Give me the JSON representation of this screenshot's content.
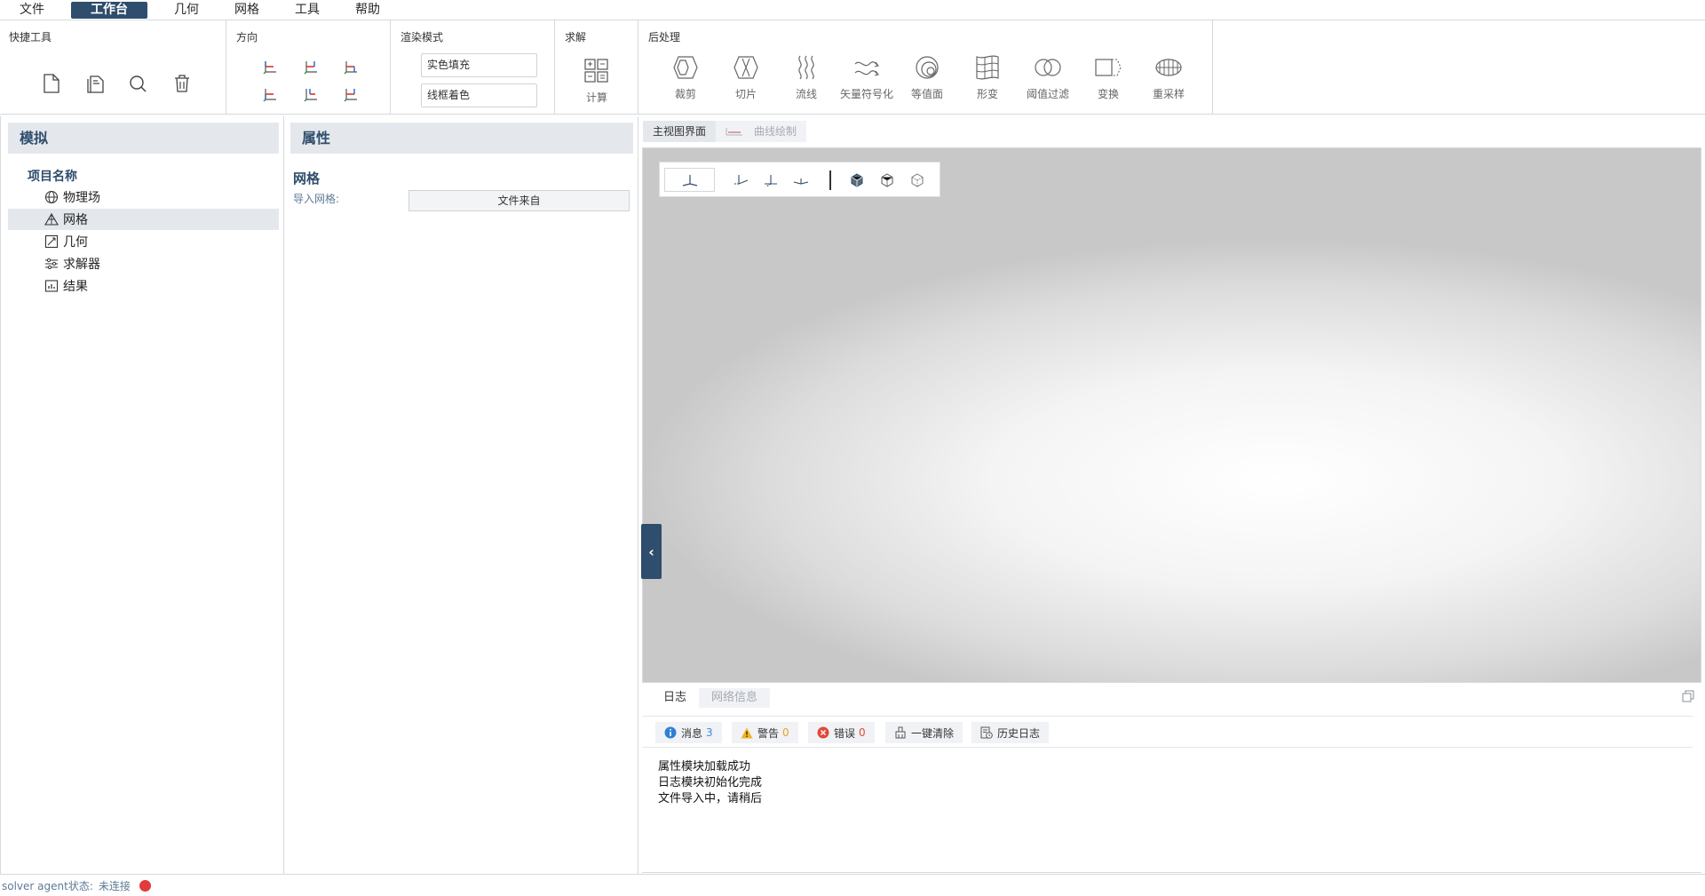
{
  "menu": {
    "items": [
      "文件",
      "工作台",
      "几何",
      "网格",
      "工具",
      "帮助"
    ],
    "active_index": 1
  },
  "ribbon": {
    "quick_tools": {
      "title": "快捷工具",
      "buttons": [
        "new-file-icon",
        "copy-file-icon",
        "search-icon",
        "trash-icon"
      ]
    },
    "direction": {
      "title": "方向",
      "buttons": [
        "view-x-pos-icon",
        "view-y-pos-icon",
        "view-z-pos-icon",
        "view-x-neg-icon",
        "view-y-neg-icon",
        "view-z-neg-icon"
      ]
    },
    "render_mode": {
      "title": "渲染模式",
      "options": [
        "实色填充",
        "线框着色"
      ]
    },
    "solve": {
      "title": "求解",
      "compute_label": "计算"
    },
    "postprocess": {
      "title": "后处理",
      "tools": [
        "裁剪",
        "切片",
        "流线",
        "矢量符号化",
        "等值面",
        "形变",
        "阈值过滤",
        "变换",
        "重采样"
      ]
    }
  },
  "left_panel": {
    "header": "模拟",
    "root": "项目名称",
    "items": [
      "物理场",
      "网格",
      "几何",
      "求解器",
      "结果"
    ],
    "selected_index": 1
  },
  "property_panel": {
    "header": "属性",
    "section_title": "网格",
    "import_label": "导入网格:",
    "import_button": "文件来自"
  },
  "view": {
    "tabs": [
      "主视图界面",
      "曲线绘制"
    ],
    "active_tab": 0
  },
  "log": {
    "tabs": [
      "日志",
      "网络信息"
    ],
    "active_tab": 0,
    "filters": {
      "info_label": "消息",
      "info_count": "3",
      "warning_label": "警告",
      "warning_count": "0",
      "error_label": "错误",
      "error_count": "0",
      "clear_label": "一键清除",
      "history_label": "历史日志"
    },
    "messages": [
      "属性模块加载成功",
      "日志模块初始化完成",
      "文件导入中，请稍后"
    ]
  },
  "status": {
    "label": "solver agent状态:",
    "value": "未连接",
    "indicator_color": "#e23b3b"
  }
}
